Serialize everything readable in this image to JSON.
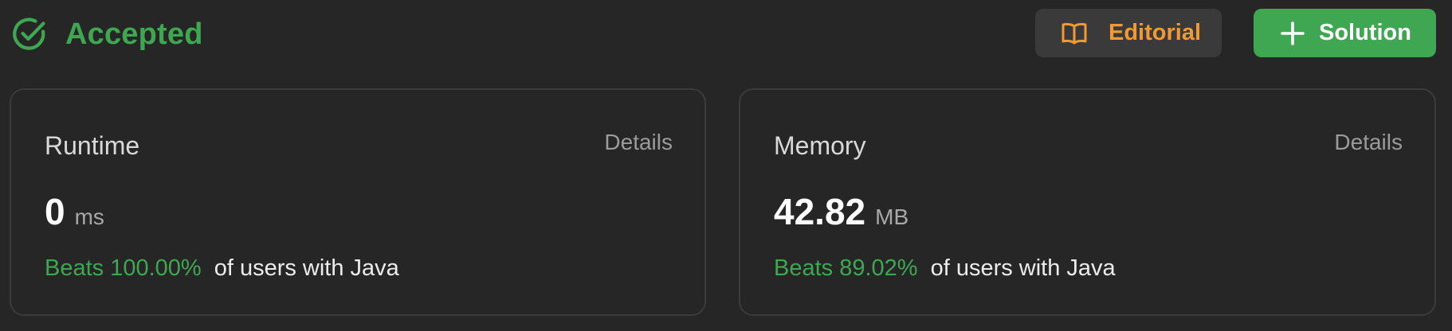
{
  "header": {
    "status_label": "Accepted",
    "status_icon": "check-circle-icon",
    "editorial_label": "Editorial",
    "editorial_icon": "book-icon",
    "solution_label": "Solution",
    "solution_icon": "plus-icon"
  },
  "runtime": {
    "title": "Runtime",
    "details_label": "Details",
    "value": "0",
    "unit": "ms",
    "beats": "Beats 100.00%",
    "beats_suffix": "of users with Java"
  },
  "memory": {
    "title": "Memory",
    "details_label": "Details",
    "value": "42.82",
    "unit": "MB",
    "beats": "Beats 89.02%",
    "beats_suffix": "of users with Java"
  },
  "colors": {
    "background": "#262626",
    "accent_green": "#3fa752",
    "editorial_orange": "#f19a33",
    "card_border": "#3b3b3b"
  }
}
